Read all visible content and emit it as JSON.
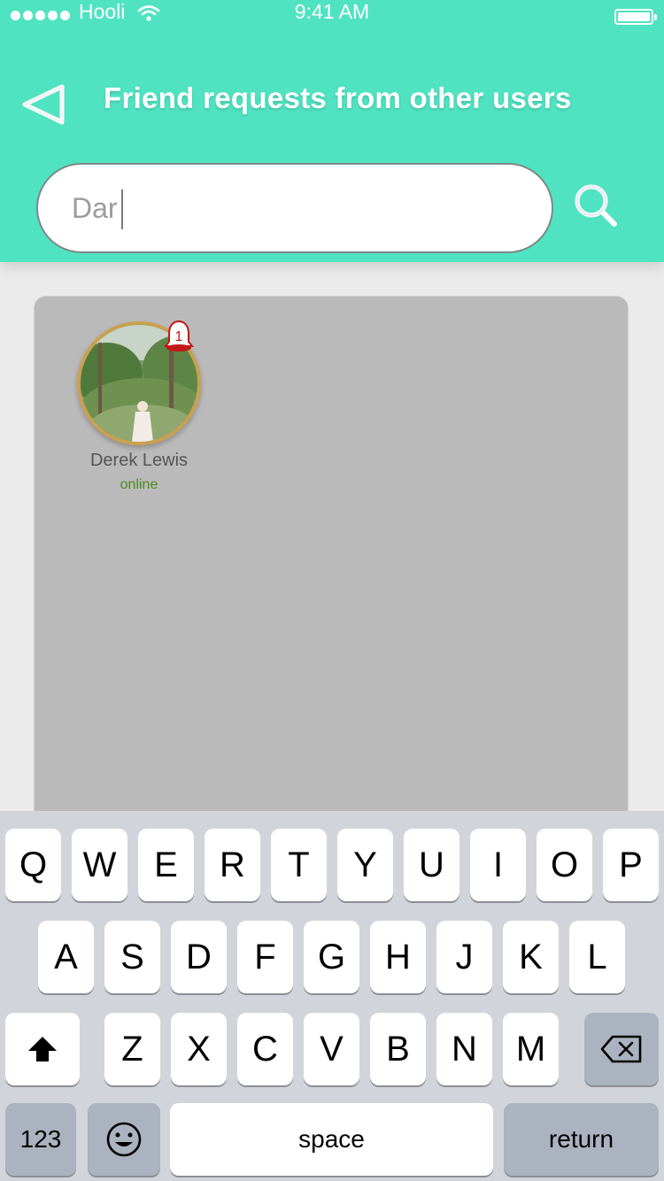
{
  "status_bar": {
    "carrier": "Hooli",
    "time": "9:41 AM"
  },
  "header": {
    "title": "Friend requests from other users",
    "search": {
      "value": "Dar",
      "placeholder": ""
    }
  },
  "results": [
    {
      "name": "Derek Lewis",
      "status": "online",
      "notification_count": "1"
    }
  ],
  "colors": {
    "header_bg": "#50e3c2",
    "card_bg": "#bababa",
    "online": "#4a8a1a",
    "avatar_ring": "#c9a04f"
  },
  "keyboard": {
    "row1": [
      "Q",
      "W",
      "E",
      "R",
      "T",
      "Y",
      "U",
      "I",
      "O",
      "P"
    ],
    "row2": [
      "A",
      "S",
      "D",
      "F",
      "G",
      "H",
      "J",
      "K",
      "L"
    ],
    "row3": [
      "Z",
      "X",
      "C",
      "V",
      "B",
      "N",
      "M"
    ],
    "numbers_label": "123",
    "space_label": "space",
    "return_label": "return",
    "icons": {
      "shift": "shift-icon",
      "delete": "backspace-icon",
      "emoji": "emoji-icon"
    }
  }
}
